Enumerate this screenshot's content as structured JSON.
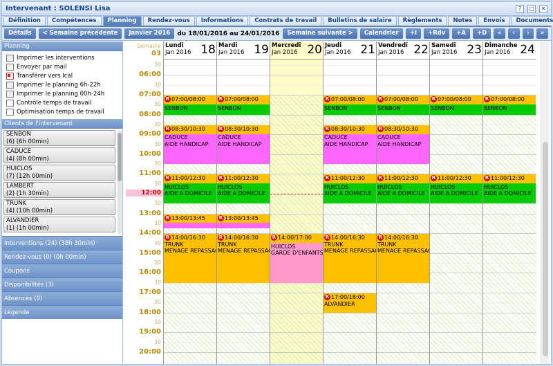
{
  "window": {
    "title": "Intervenant : SOLENSI Lisa",
    "buttons": [
      "?",
      "□",
      "✕"
    ]
  },
  "tabs": [
    {
      "label": "Définition",
      "active": false
    },
    {
      "label": "Compétences",
      "active": false
    },
    {
      "label": "Planning",
      "active": true
    },
    {
      "label": "Rendez-vous",
      "active": false
    },
    {
      "label": "Informations",
      "active": false
    },
    {
      "label": "Contrats de travail",
      "active": false
    },
    {
      "label": "Bulletins de salaire",
      "active": false
    },
    {
      "label": "Règlements",
      "active": false
    },
    {
      "label": "Notes",
      "active": false
    },
    {
      "label": "Envois",
      "active": false
    },
    {
      "label": "Documents",
      "active": false
    }
  ],
  "toolbar": {
    "details": "Détails",
    "prev_week": "< Semaine précédente",
    "month": "Janvier 2016",
    "range": "du 18/01/2016 au 24/01/2016",
    "next_week": "Semaine suivante >",
    "calendar": "Calendrier",
    "add_i": "+I",
    "add_rdv": "+Rdv",
    "add_a": "+A",
    "add_d": "+D",
    "first": "«",
    "prev": "‹",
    "next": "›",
    "last": "»"
  },
  "sidebar": {
    "planning_header": "Planning",
    "menu": [
      {
        "label": "Imprimer les interventions",
        "icon": "printer-icon"
      },
      {
        "label": "Envoyer par mail",
        "icon": "mail-icon"
      },
      {
        "label": "Transférer vers Ical",
        "icon": "pdf-icon"
      },
      {
        "label": "Imprimer le planning 6h-22h",
        "icon": "printer-icon"
      },
      {
        "label": "Imprimer le planning 00h-24h",
        "icon": "printer-icon"
      },
      {
        "label": "Contrôle temps de travail",
        "icon": "document-icon"
      },
      {
        "label": "Optimisation temps de travail",
        "icon": "document-icon"
      }
    ],
    "clients_header": "Clients de l'intervenant",
    "clients": [
      {
        "name": "SENBON",
        "detail": "(6) (6h 00min)"
      },
      {
        "name": "CADUCE",
        "detail": "(4) (8h 00min)"
      },
      {
        "name": "HUICLOS",
        "detail": "(7) (12h 00min)"
      },
      {
        "name": "LAMBERT",
        "detail": "(2) (1h 30min)"
      },
      {
        "name": "TRUNK",
        "detail": "(4) (10h 00min)"
      },
      {
        "name": "ALVANDIER",
        "detail": "(1) (1h 00min)"
      }
    ],
    "sections": [
      "Interventions (24) (38h 30min)",
      "Rendez-vous (0) (0h 00min)",
      "Coupons",
      "Disponibilités (3)",
      "Absences (0)",
      "Légende"
    ]
  },
  "calendar": {
    "week_label": "Semaine",
    "week_number": "03",
    "hours": [
      "06:00",
      "07:00",
      "08:00",
      "09:00",
      "10:00",
      "11:00",
      "12:00",
      "13:00",
      "14:00",
      "15:00",
      "16:00",
      "17:00",
      "18:00",
      "19:00",
      "20:00"
    ],
    "half_label": "30",
    "current_time": "12:00",
    "days": [
      {
        "name": "Lundi",
        "month": "Jan 2016",
        "date": "18"
      },
      {
        "name": "Mardi",
        "month": "Jan 2016",
        "date": "19"
      },
      {
        "name": "Mercredi",
        "month": "Jan 2016",
        "date": "20"
      },
      {
        "name": "Jeudi",
        "month": "Jan 2016",
        "date": "21"
      },
      {
        "name": "Vendredi",
        "month": "Jan 2016",
        "date": "22"
      },
      {
        "name": "Samedi",
        "month": "Jan 2016",
        "date": "23"
      },
      {
        "name": "Dimanche",
        "month": "Jan 2016",
        "date": "24"
      }
    ],
    "today_index": 2,
    "colors": {
      "orange": "#ffc000",
      "green": "#00cc00",
      "pink": "#ff66ff",
      "lightpink": "#ff99cc",
      "hatch": "#d4ecb4"
    },
    "events": [
      {
        "day": 0,
        "start": 7,
        "end": 8,
        "time": "07:00/08:00",
        "client": "SENBON",
        "service": "",
        "color": "green"
      },
      {
        "day": 1,
        "start": 7,
        "end": 8,
        "time": "07:00/08:00",
        "client": "SENBON",
        "service": "",
        "color": "green"
      },
      {
        "day": 3,
        "start": 7,
        "end": 8,
        "time": "07:00/08:00",
        "client": "SENBON",
        "service": "",
        "color": "green"
      },
      {
        "day": 4,
        "start": 7,
        "end": 8,
        "time": "07:00/08:00",
        "client": "SENBON",
        "service": "",
        "color": "green"
      },
      {
        "day": 5,
        "start": 7,
        "end": 8,
        "time": "07:00/08:00",
        "client": "SENBON",
        "service": "",
        "color": "green"
      },
      {
        "day": 6,
        "start": 7,
        "end": 8,
        "time": "07:00/08:00",
        "client": "SENBON",
        "service": "",
        "color": "green"
      },
      {
        "day": 0,
        "start": 8.5,
        "end": 10.5,
        "time": "08:30/10:30",
        "client": "CADUCE",
        "service": "AIDE HANDICAP",
        "color": "pink"
      },
      {
        "day": 1,
        "start": 8.5,
        "end": 10.5,
        "time": "08:30/10:30",
        "client": "CADUCE",
        "service": "AIDE HANDICAP",
        "color": "pink"
      },
      {
        "day": 3,
        "start": 8.5,
        "end": 10.5,
        "time": "08:30/10:30",
        "client": "CADUCE",
        "service": "AIDE HANDICAP",
        "color": "pink"
      },
      {
        "day": 4,
        "start": 8.5,
        "end": 10.5,
        "time": "08:30/10:30",
        "client": "CADUCE",
        "service": "AIDE HANDICAP",
        "color": "pink"
      },
      {
        "day": 0,
        "start": 11,
        "end": 12.5,
        "time": "11:00/12:30",
        "client": "HUICLOS",
        "service": "AIDE A DOMICILE",
        "color": "green"
      },
      {
        "day": 1,
        "start": 11,
        "end": 12.5,
        "time": "11:00/12:30",
        "client": "HUICLOS",
        "service": "AIDE A DOMICILE",
        "color": "green"
      },
      {
        "day": 3,
        "start": 11,
        "end": 12.5,
        "time": "11:00/12:30",
        "client": "HUICLOS",
        "service": "AIDE A DOMICILE",
        "color": "green"
      },
      {
        "day": 4,
        "start": 11,
        "end": 12.5,
        "time": "11:00/12:30",
        "client": "HUICLOS",
        "service": "AIDE A DOMICILE",
        "color": "green"
      },
      {
        "day": 5,
        "start": 11,
        "end": 12.5,
        "time": "11:00/12:30",
        "client": "HUICLOS",
        "service": "AIDE A DOMICILE",
        "color": "green"
      },
      {
        "day": 6,
        "start": 11,
        "end": 12.5,
        "time": "11:00/12:30",
        "client": "HUICLOS",
        "service": "AIDE A DOMICILE",
        "color": "green"
      },
      {
        "day": 0,
        "start": 13,
        "end": 13.75,
        "time": "13:00/13:45",
        "client": "",
        "service": "",
        "color": "pink"
      },
      {
        "day": 1,
        "start": 13,
        "end": 13.75,
        "time": "13:00/13:45",
        "client": "",
        "service": "",
        "color": "pink"
      },
      {
        "day": 0,
        "start": 14,
        "end": 16.5,
        "time": "14:00/16:30",
        "client": "TRUNK",
        "service": "MENAGE REPASSAGE",
        "color": "orange"
      },
      {
        "day": 1,
        "start": 14,
        "end": 16.5,
        "time": "14:00/16:30",
        "client": "TRUNK",
        "service": "MENAGE REPASSAGE",
        "color": "orange"
      },
      {
        "day": 2,
        "start": 14,
        "end": 16.5,
        "time": "14:00/17:00",
        "client": "HUICLOS",
        "service": "GARDE D'ENFANTS +",
        "color": "lightpink"
      },
      {
        "day": 3,
        "start": 14,
        "end": 16.5,
        "time": "14:00/16:30",
        "client": "TRUNK",
        "service": "MENAGE REPASSAGE",
        "color": "orange"
      },
      {
        "day": 4,
        "start": 14,
        "end": 16.5,
        "time": "14:00/16:30",
        "client": "TRUNK",
        "service": "MENAGE REPASSAGE",
        "color": "orange"
      },
      {
        "day": 3,
        "start": 17,
        "end": 18,
        "time": "17:00/18:00",
        "client": "ALVANDIER",
        "service": "",
        "color": "orange"
      }
    ]
  }
}
